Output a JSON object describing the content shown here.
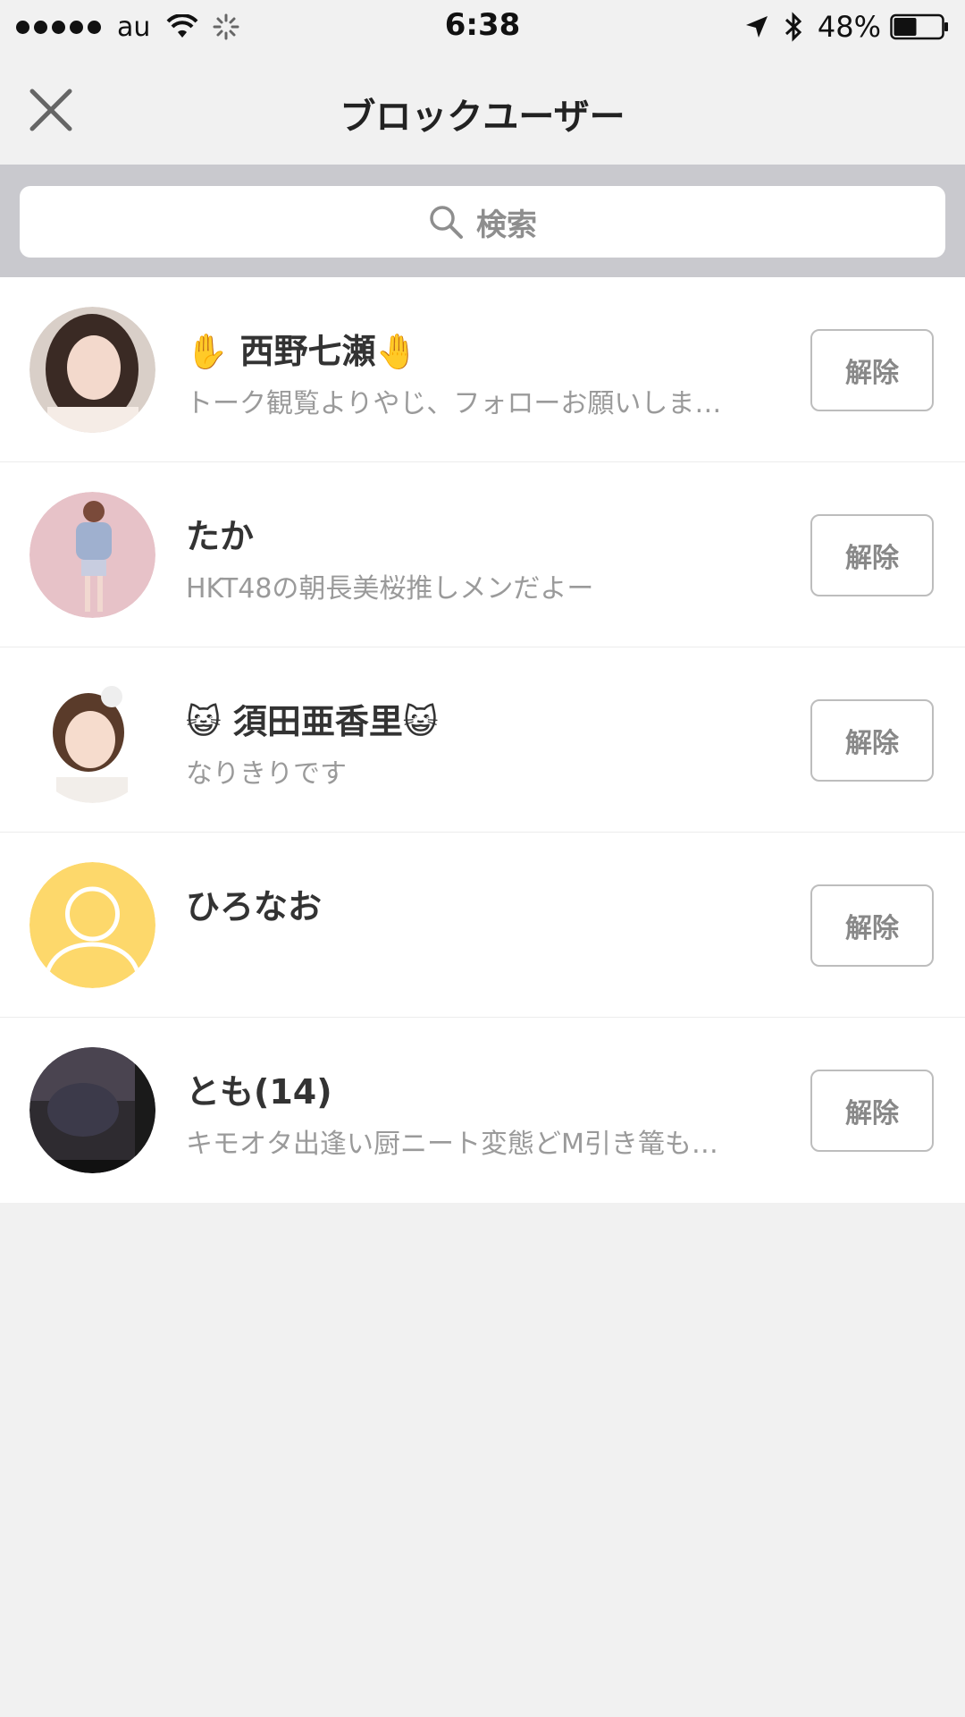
{
  "status_bar": {
    "carrier": "au",
    "time": "6:38",
    "battery_percent": "48%",
    "battery_level": 0.48,
    "icons": [
      "signal-dots",
      "wifi-icon",
      "activity-spinner-icon",
      "location-arrow-icon",
      "bluetooth-icon",
      "battery-icon"
    ]
  },
  "nav": {
    "title": "ブロックユーザー",
    "close_icon": "close-icon"
  },
  "search": {
    "placeholder": "検索",
    "icon": "search-icon"
  },
  "users": [
    {
      "name": "✋ 西野七瀬🤚",
      "bio": "トーク観覧よりやじ、フォローお願いしま…",
      "avatar": "photo",
      "action_label": "解除"
    },
    {
      "name": "たか",
      "bio": "HKT48の朝長美桜推しメンだよー",
      "avatar": "photo",
      "action_label": "解除"
    },
    {
      "name": "😺 須田亜香里😺",
      "bio": "なりきりです",
      "avatar": "photo",
      "action_label": "解除"
    },
    {
      "name": "ひろなお",
      "bio": "",
      "avatar": "default-user-icon",
      "action_label": "解除"
    },
    {
      "name": "とも(14)",
      "bio": "キモオタ出逢い厨ニート変態どM引き篭も…",
      "avatar": "photo",
      "action_label": "解除"
    }
  ],
  "colors": {
    "background": "#f1f1f1",
    "search_band": "#c9c9ce",
    "default_avatar": "#fdd86b",
    "button_border": "#bdbdbd",
    "button_text": "#888888"
  }
}
